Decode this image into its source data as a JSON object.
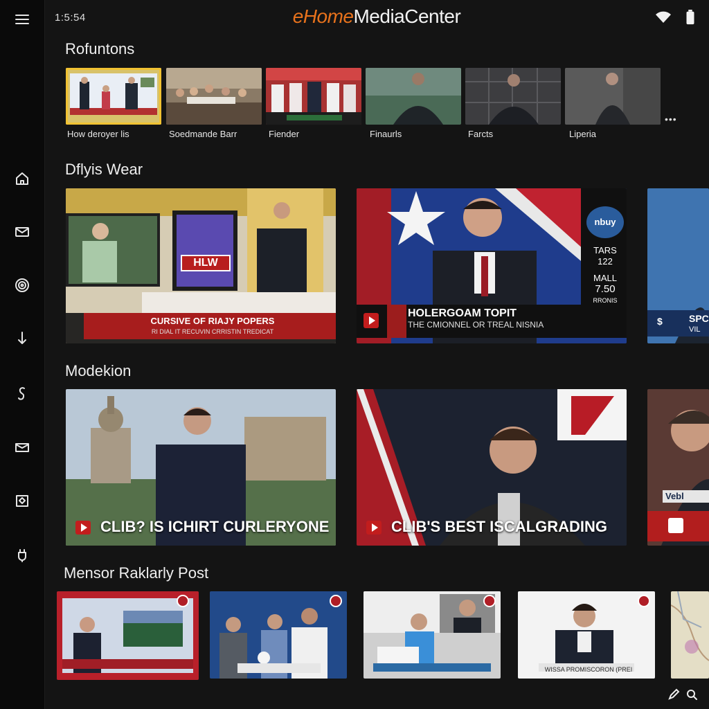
{
  "status": {
    "time": "1:5:54"
  },
  "app": {
    "title_accent": "eHome",
    "title_rest": "MediaCenter"
  },
  "sidebar": {
    "items": [
      {
        "name": "menu-icon"
      },
      {
        "name": "home-icon"
      },
      {
        "name": "mail-icon"
      },
      {
        "name": "spiral-icon"
      },
      {
        "name": "download-icon"
      },
      {
        "name": "link-icon"
      },
      {
        "name": "envelope-icon"
      },
      {
        "name": "map-icon"
      },
      {
        "name": "plug-icon"
      }
    ]
  },
  "sections": {
    "s1": {
      "title": "Rofuntons",
      "items": [
        {
          "caption": "How deroyer lis",
          "selected": true
        },
        {
          "caption": "Soedmande Barr",
          "selected": false
        },
        {
          "caption": "Fiender",
          "selected": false
        },
        {
          "caption": "Finaurls",
          "selected": false
        },
        {
          "caption": "Farcts",
          "selected": false
        },
        {
          "caption": "Liperia",
          "selected": false
        }
      ],
      "more": "•••"
    },
    "s2": {
      "title": "Dflyis Wear",
      "cards": [
        {
          "screen_text": "HLW",
          "ticker": "CURSIVE OF RIAJY POPERS",
          "ticker_sub": "RI DIAL IT RECUVIN CRRISTIN TREDICAT"
        },
        {
          "ticker": "HOLERGOAM TOPIT",
          "ticker_sub": "THE CMIONNEL OR TREAL NISNIA",
          "side_logo": "nbuy",
          "side_lines": [
            "TARS 122",
            "MALL",
            "7.50",
            "RRONIS"
          ]
        },
        {
          "ticker": "SPC",
          "ticker_sub": "VIL"
        }
      ]
    },
    "s3": {
      "title": "Modekion",
      "cards": [
        {
          "caption": "CLIB? IS ICHIRT CURLERYONE"
        },
        {
          "caption": "CLIB'S BEST ISCALGRADING"
        },
        {
          "caption": "Vebl"
        }
      ]
    },
    "s4": {
      "title": "Mensor Raklarly Post",
      "items": [
        {
          "caption": ""
        },
        {
          "caption": ""
        },
        {
          "caption": ""
        },
        {
          "caption": "WISSA PROMISCORON (PREI"
        },
        {
          "caption": ""
        }
      ]
    }
  },
  "colors": {
    "accent": "#e8721c",
    "selected": "#f1c232",
    "news_red": "#a71d1d"
  }
}
